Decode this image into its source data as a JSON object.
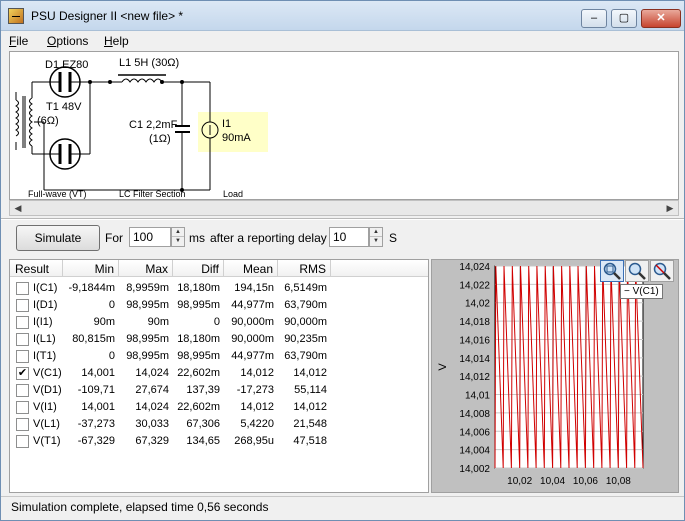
{
  "window": {
    "title": "PSU Designer II  <new file> *",
    "controls": {
      "minimize": "–",
      "maximize": "▢",
      "close": "✕"
    }
  },
  "menu": {
    "file": {
      "key": "F",
      "rest": "ile"
    },
    "options": {
      "key": "O",
      "rest": "ptions"
    },
    "help": {
      "key": "H",
      "rest": "elp"
    }
  },
  "schematic": {
    "rectifier": "D1 EZ80",
    "transformer_line1": "T1 48V",
    "transformer_line2": "(6Ω)",
    "inductor": "L1 5H (30Ω)",
    "capacitor_line1": "C1 2,2mF",
    "capacitor_line2": "(1Ω)",
    "load_line1": "I1",
    "load_line2": "90mA",
    "section_fullwave": "Full-wave (VT)",
    "section_filter": "LC Filter Section",
    "section_load": "Load"
  },
  "controls": {
    "simulate_label": "Simulate",
    "for_label": "For",
    "duration_value": "100",
    "duration_unit": "ms",
    "delay_label": "after a reporting delay of",
    "delay_value": "10",
    "delay_unit": "S"
  },
  "results": {
    "headers": [
      "Result",
      "Min",
      "Max",
      "Diff",
      "Mean",
      "RMS"
    ],
    "rows": [
      {
        "name": "I(C1)",
        "checked": false,
        "min": "-9,1844m",
        "max": "8,9959m",
        "diff": "18,180m",
        "mean": "194,15n",
        "rms": "6,5149m"
      },
      {
        "name": "I(D1)",
        "checked": false,
        "min": "0",
        "max": "98,995m",
        "diff": "98,995m",
        "mean": "44,977m",
        "rms": "63,790m"
      },
      {
        "name": "I(I1)",
        "checked": false,
        "min": "90m",
        "max": "90m",
        "diff": "0",
        "mean": "90,000m",
        "rms": "90,000m"
      },
      {
        "name": "I(L1)",
        "checked": false,
        "min": "80,815m",
        "max": "98,995m",
        "diff": "18,180m",
        "mean": "90,000m",
        "rms": "90,235m"
      },
      {
        "name": "I(T1)",
        "checked": false,
        "min": "0",
        "max": "98,995m",
        "diff": "98,995m",
        "mean": "44,977m",
        "rms": "63,790m"
      },
      {
        "name": "V(C1)",
        "checked": true,
        "min": "14,001",
        "max": "14,024",
        "diff": "22,602m",
        "mean": "14,012",
        "rms": "14,012"
      },
      {
        "name": "V(D1)",
        "checked": false,
        "min": "-109,71",
        "max": "27,674",
        "diff": "137,39",
        "mean": "-17,273",
        "rms": "55,114"
      },
      {
        "name": "V(I1)",
        "checked": false,
        "min": "14,001",
        "max": "14,024",
        "diff": "22,602m",
        "mean": "14,012",
        "rms": "14,012"
      },
      {
        "name": "V(L1)",
        "checked": false,
        "min": "-37,273",
        "max": "30,033",
        "diff": "67,306",
        "mean": "5,4220",
        "rms": "21,548"
      },
      {
        "name": "V(T1)",
        "checked": false,
        "min": "-67,329",
        "max": "67,329",
        "diff": "134,65",
        "mean": "268,95u",
        "rms": "47,518"
      }
    ]
  },
  "plot": {
    "tooltip": "− V(C1)",
    "trace_color": "#d00000",
    "zoom_icons": [
      "zoom-fit-icon",
      "zoom-in-icon",
      "zoom-out-icon"
    ]
  },
  "chart_data": {
    "type": "line",
    "ylabel": "V",
    "xlabel": "",
    "ylim": [
      14.002,
      14.024
    ],
    "xlim": [
      10.005,
      10.095
    ],
    "y_ticks": [
      14.002,
      14.004,
      14.006,
      14.008,
      14.01,
      14.012,
      14.014,
      14.016,
      14.018,
      14.02,
      14.022,
      14.024
    ],
    "y_tick_labels": [
      "14,002",
      "14,004",
      "14,006",
      "14,008",
      "14,01",
      "14,012",
      "14,014",
      "14,016",
      "14,018",
      "14,02",
      "14,022",
      "14,024"
    ],
    "x_ticks": [
      10.02,
      10.04,
      10.06,
      10.08
    ],
    "x_tick_labels": [
      "10,02",
      "10,04",
      "10,06",
      "10,08"
    ],
    "grid": true,
    "series": [
      {
        "color": "#d00000",
        "x": [
          10.005,
          10.0055,
          10.01,
          10.0105,
          10.015,
          10.0155,
          10.02,
          10.0205,
          10.025,
          10.0255,
          10.03,
          10.0305,
          10.035,
          10.0355,
          10.04,
          10.0405,
          10.045,
          10.0455,
          10.05,
          10.0505,
          10.055,
          10.0555,
          10.06,
          10.0605,
          10.065,
          10.0655,
          10.07,
          10.0705,
          10.075,
          10.0755,
          10.08,
          10.0805,
          10.085,
          10.0855,
          10.09,
          10.0905,
          10.095
        ],
        "values": [
          14.001,
          14.024,
          14.001,
          14.024,
          14.001,
          14.024,
          14.001,
          14.024,
          14.001,
          14.024,
          14.001,
          14.024,
          14.001,
          14.024,
          14.001,
          14.024,
          14.001,
          14.024,
          14.001,
          14.024,
          14.001,
          14.024,
          14.001,
          14.024,
          14.001,
          14.024,
          14.001,
          14.024,
          14.001,
          14.024,
          14.001,
          14.024,
          14.001,
          14.024,
          14.001,
          14.024,
          14.001
        ]
      }
    ]
  },
  "status": {
    "text": "Simulation complete, elapsed time 0,56 seconds"
  }
}
